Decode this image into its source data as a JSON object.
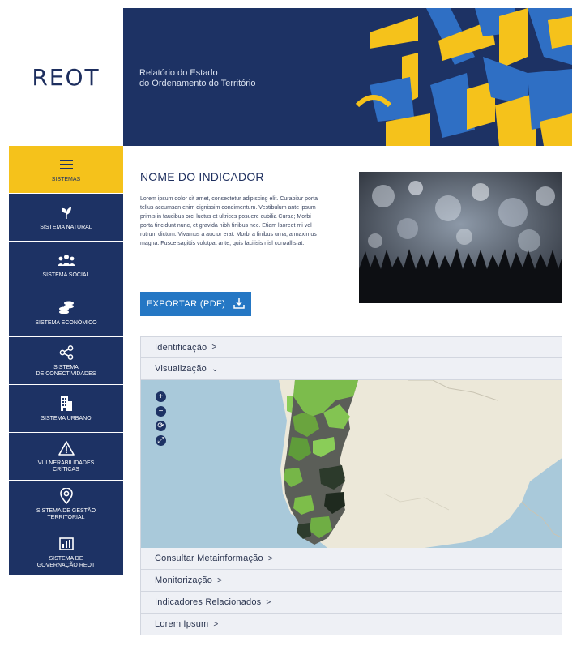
{
  "brand": {
    "logo": "REOT",
    "subtitle_line1": "Relatório do Estado",
    "subtitle_line2": "do Ordenamento do Território"
  },
  "sidebar": {
    "items": [
      {
        "label": "SISTEMAS",
        "icon": "menu-icon",
        "active": true
      },
      {
        "label": "SISTEMA NATURAL",
        "icon": "leaf-icon"
      },
      {
        "label": "SISTEMA SOCIAL",
        "icon": "people-icon"
      },
      {
        "label": "SISTEMA ECONÓMICO",
        "icon": "coins-icon"
      },
      {
        "label_line1": "SISTEMA",
        "label_line2": "DE CONECTIVIDADES",
        "icon": "share-icon"
      },
      {
        "label": "SISTEMA URBANO",
        "icon": "building-icon"
      },
      {
        "label_line1": "VULNERABILIDADES",
        "label_line2": "CRÍTICAS",
        "icon": "warning-icon"
      },
      {
        "label_line1": "SISTEMA DE GESTÃO",
        "label_line2": "TERRITORIAL",
        "icon": "location-pin-icon"
      },
      {
        "label_line1": "SISTEMA DE",
        "label_line2": "GOVERNAÇÃO REOT",
        "icon": "bar-chart-icon"
      }
    ]
  },
  "main": {
    "title": "NOME DO INDICADOR",
    "description": "Lorem ipsum dolor sit amet, consectetur adipiscing elit. Curabitur porta tellus accumsan enim dignissim condimentum. Vestibulum ante ipsum primis in faucibus orci luctus et ultrices posuere cubilia Curae; Morbi porta tincidunt nunc, et gravida nibh finibus nec. Etiam laoreet mi vel rutrum dictum. Vivamus a auctor erat. Morbi a finibus urna, a maximus magna. Fusce sagittis volutpat ante, quis facilisis nisl convallis at.",
    "export_label": "EXPORTAR (PDF)"
  },
  "accordion": {
    "identificacao": "Identificação",
    "visualizacao": "Visualização",
    "metainformacao": "Consultar Metainformação",
    "monitorizacao": "Monitorização",
    "relacionados": "Indicadores Relacionados",
    "lorem": "Lorem Ipsum"
  },
  "map_controls": [
    "+",
    "−",
    "⟳",
    "⤢"
  ],
  "colors": {
    "navy": "#1d3264",
    "yellow": "#f5c21b",
    "blue": "#2577c4",
    "map_light_green": "#7dbe4a",
    "map_dark": "#2b3a2b"
  }
}
